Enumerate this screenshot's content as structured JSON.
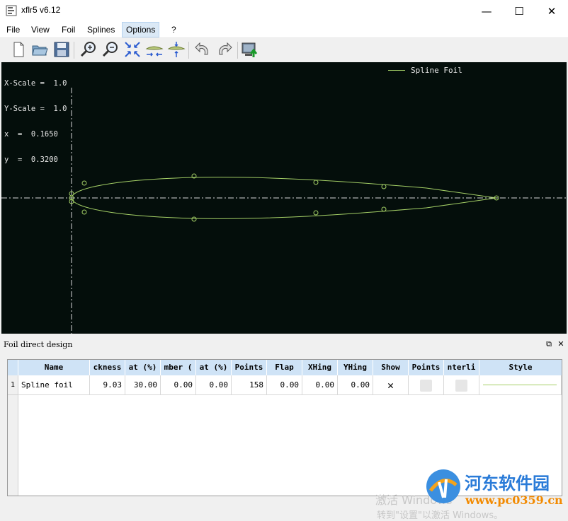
{
  "window": {
    "title": "xflr5 v6.12",
    "minimize": "—",
    "maximize": "☐",
    "close": "✕"
  },
  "menu": {
    "items": [
      "File",
      "View",
      "Foil",
      "Splines",
      "Options",
      "?"
    ],
    "active_item": "Options"
  },
  "toolbar": {
    "buttons": [
      "new-file",
      "open-file",
      "save",
      "zoom-in",
      "zoom-out",
      "reset-view",
      "reset-x-scale",
      "reset-y-scale",
      "undo",
      "redo",
      "export"
    ]
  },
  "canvas": {
    "background": "#040e0b",
    "foil_color": "#a4cf66",
    "scale_info": {
      "x_scale": "X-Scale =  1.0",
      "y_scale": "Y-Scale =  1.0",
      "x": "x  =  0.1650",
      "y": "y  =  0.3200"
    },
    "legend_label": "Spline Foil"
  },
  "panel": {
    "title": "Foil direct design",
    "float_icon": "⧉",
    "close_icon": "✕"
  },
  "table": {
    "headers": [
      "Name",
      "ckness",
      "at (%)",
      "mber (",
      "at (%)",
      "Points",
      "Flap",
      "XHing",
      "YHing",
      "Show",
      "Points",
      "nterli",
      "Style"
    ],
    "rows": [
      {
        "index": "1",
        "name": "Spline foil",
        "thickness": "9.03",
        "thickness_at": "30.00",
        "camber": "0.00",
        "camber_at": "0.00",
        "points": "158",
        "flap": "0.00",
        "xhinge": "0.00",
        "yhinge": "0.00",
        "show": "✕"
      }
    ]
  },
  "watermark": {
    "activate_line1": "激活 Windows",
    "activate_line2": "转到\"设置\"以激活 Windows。",
    "brand": "河东软件园",
    "url": "www.pc0359.cn"
  }
}
